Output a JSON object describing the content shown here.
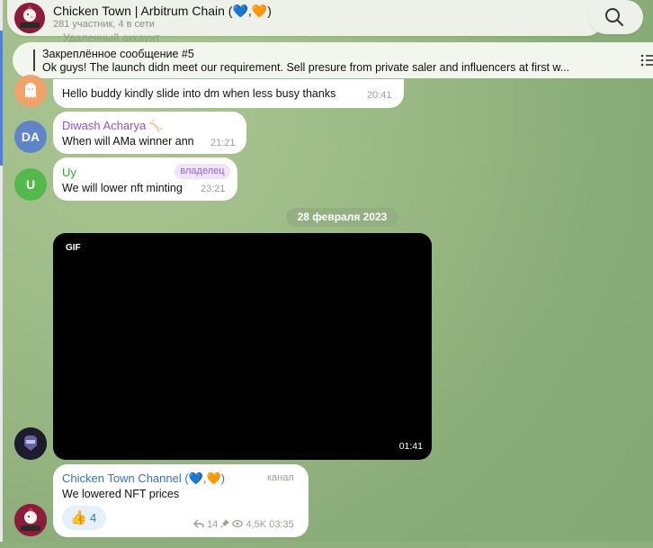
{
  "header": {
    "title": "Chicken Town | Arbitrum Chain (💙,🧡)",
    "subtitle": "281 участник, 4 в сети",
    "avatar_text": "Chicken Town"
  },
  "deleted_account_label": "Удаленный аккаунт",
  "pinned": {
    "title": "Закреплённое сообщение #5",
    "text": "Ok guys! The launch didn meet our requirement. Sell presure from private saler and influencers at first w..."
  },
  "messages": [
    {
      "text": "Hello buddy kindly slide into dm when less busy thanks",
      "time": "20:41"
    },
    {
      "sender": "Diwash Acharya",
      "sender_emoji": "🦴",
      "avatar_initials": "DA",
      "text": "When will AMa winner ann",
      "time": "21:21"
    },
    {
      "sender": "Uy",
      "avatar_initials": "U",
      "badge": "владелец",
      "text": "We will lower nft minting",
      "time": "23:21"
    }
  ],
  "date_separator": "28 февраля 2023",
  "gif": {
    "label": "GIF",
    "duration": "01:41"
  },
  "channel_post": {
    "sender": "Chicken Town Channel (💙,🧡)",
    "role": "канал",
    "text": "We lowered NFT prices",
    "reaction_emoji": "👍",
    "reaction_count": "4",
    "replies": "14",
    "views": "4,5K",
    "time": "03:35"
  },
  "colors": {
    "accent": "#4a86c8",
    "sender_da": "#9b4fd1",
    "sender_uy": "#3ea23e",
    "sender_channel": "#3a74b6",
    "avatar_da": "#5f84c9",
    "avatar_u": "#54b94d",
    "avatar_ghost": "#f0a26a"
  }
}
